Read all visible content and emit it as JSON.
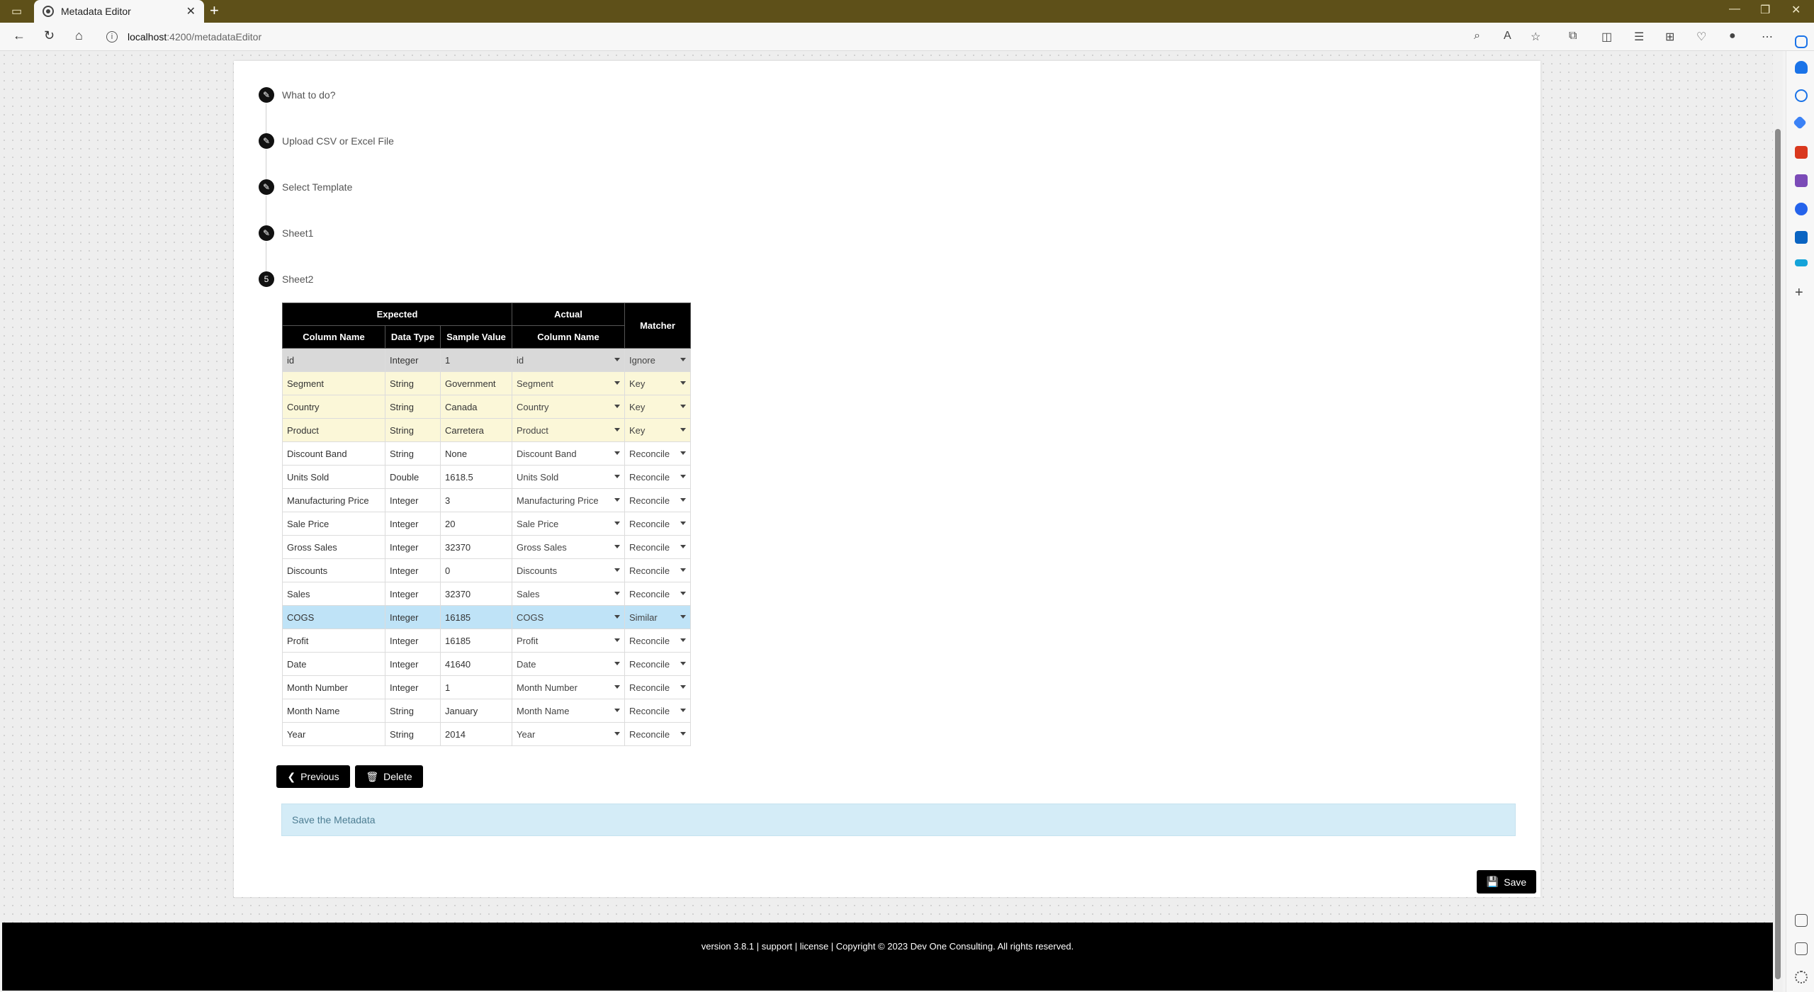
{
  "browser": {
    "tab_title": "Metadata Editor",
    "tab_close": "✕",
    "new_tab": "+",
    "url_host": "localhost",
    "url_path": ":4200/metadataEditor"
  },
  "steps": [
    {
      "label": "What to do?",
      "marker": "✎"
    },
    {
      "label": "Upload CSV or Excel File",
      "marker": "✎"
    },
    {
      "label": "Select Template",
      "marker": "✎"
    },
    {
      "label": "Sheet1",
      "marker": "✎"
    },
    {
      "label": "Sheet2",
      "marker": "5"
    }
  ],
  "table": {
    "group_headers": {
      "expected": "Expected",
      "actual": "Actual",
      "matcher": "Matcher"
    },
    "columns": {
      "column_name": "Column Name",
      "data_type": "Data Type",
      "sample_value": "Sample Value",
      "actual_column_name": "Column Name"
    },
    "rows": [
      {
        "name": "id",
        "type": "Integer",
        "sample": "1",
        "actual": "id",
        "matcher": "Ignore"
      },
      {
        "name": "Segment",
        "type": "String",
        "sample": "Government",
        "actual": "Segment",
        "matcher": "Key"
      },
      {
        "name": "Country",
        "type": "String",
        "sample": "Canada",
        "actual": "Country",
        "matcher": "Key"
      },
      {
        "name": "Product",
        "type": "String",
        "sample": "Carretera",
        "actual": "Product",
        "matcher": "Key"
      },
      {
        "name": "Discount Band",
        "type": "String",
        "sample": "None",
        "actual": "Discount Band",
        "matcher": "Reconcile"
      },
      {
        "name": "Units Sold",
        "type": "Double",
        "sample": "1618.5",
        "actual": "Units Sold",
        "matcher": "Reconcile"
      },
      {
        "name": "Manufacturing Price",
        "type": "Integer",
        "sample": "3",
        "actual": "Manufacturing Price",
        "matcher": "Reconcile"
      },
      {
        "name": "Sale Price",
        "type": "Integer",
        "sample": "20",
        "actual": "Sale Price",
        "matcher": "Reconcile"
      },
      {
        "name": "Gross Sales",
        "type": "Integer",
        "sample": "32370",
        "actual": "Gross Sales",
        "matcher": "Reconcile"
      },
      {
        "name": "Discounts",
        "type": "Integer",
        "sample": "0",
        "actual": "Discounts",
        "matcher": "Reconcile"
      },
      {
        "name": "Sales",
        "type": "Integer",
        "sample": "32370",
        "actual": "Sales",
        "matcher": "Reconcile"
      },
      {
        "name": "COGS",
        "type": "Integer",
        "sample": "16185",
        "actual": "COGS",
        "matcher": "Similar"
      },
      {
        "name": "Profit",
        "type": "Integer",
        "sample": "16185",
        "actual": "Profit",
        "matcher": "Reconcile"
      },
      {
        "name": "Date",
        "type": "Integer",
        "sample": "41640",
        "actual": "Date",
        "matcher": "Reconcile"
      },
      {
        "name": "Month Number",
        "type": "Integer",
        "sample": "1",
        "actual": "Month Number",
        "matcher": "Reconcile"
      },
      {
        "name": "Month Name",
        "type": "String",
        "sample": "January",
        "actual": "Month Name",
        "matcher": "Reconcile"
      },
      {
        "name": "Year",
        "type": "String",
        "sample": "2014",
        "actual": "Year",
        "matcher": "Reconcile"
      }
    ]
  },
  "buttons": {
    "previous": "Previous",
    "delete": "Delete",
    "save": "Save"
  },
  "info_message": "Save the Metadata",
  "footer_text": "version 3.8.1 | support | license | Copyright © 2023 Dev One Consulting. All rights reserved.",
  "colors": {
    "row_ignore": "#d9d9d9",
    "row_key": "#fbf7d8",
    "row_similar": "#bfe3f7",
    "header": "#000000"
  }
}
